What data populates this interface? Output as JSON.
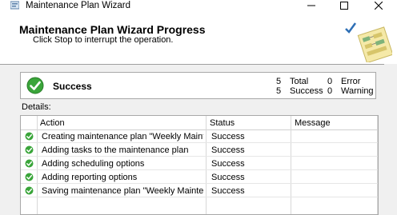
{
  "window": {
    "title": "Maintenance Plan Wizard",
    "controls": [
      "minimize",
      "maximize",
      "close"
    ]
  },
  "header": {
    "title": "Maintenance Plan Wizard Progress",
    "subtitle": "Click Stop to interrupt the operation."
  },
  "summary": {
    "status": "Success",
    "total_count": "5",
    "total_label": "Total",
    "success_count": "5",
    "success_label": "Success",
    "error_count": "0",
    "error_label": "Error",
    "warning_count": "0",
    "warning_label": "Warning"
  },
  "details": {
    "label": "Details:",
    "columns": [
      "Action",
      "Status",
      "Message"
    ],
    "rows": [
      {
        "action": "Creating maintenance plan \"Weekly Maintena...",
        "status": "Success",
        "message": ""
      },
      {
        "action": "Adding tasks to the maintenance plan",
        "status": "Success",
        "message": ""
      },
      {
        "action": "Adding scheduling options",
        "status": "Success",
        "message": ""
      },
      {
        "action": "Adding reporting options",
        "status": "Success",
        "message": ""
      },
      {
        "action": "Saving maintenance plan \"Weekly Maintenan...",
        "status": "Success",
        "message": ""
      }
    ]
  },
  "colors": {
    "success_green": "#3aa53a",
    "header_bg": "#ffffff",
    "window_bg": "#f0f0f0"
  }
}
